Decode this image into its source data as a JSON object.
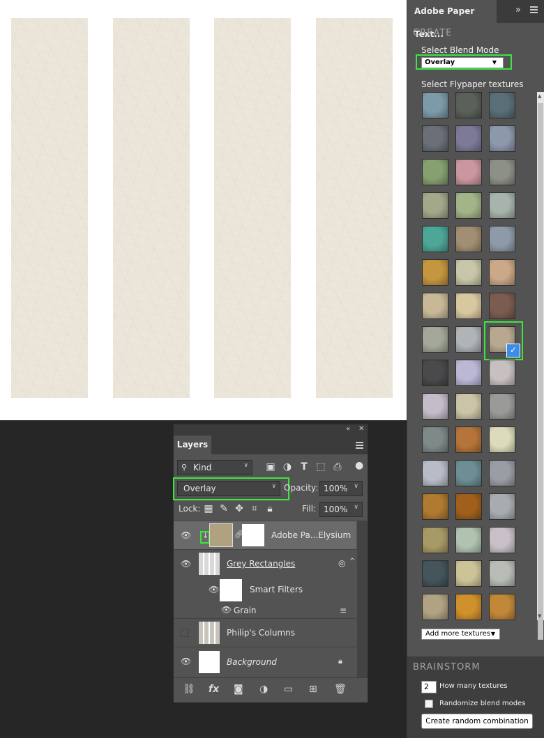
{
  "canvas": {
    "columns": 4
  },
  "panel": {
    "title": "Adobe Paper Text...",
    "create_header": "CREATE",
    "blend_label": "Select Blend Mode",
    "blend_value": "Overlay",
    "textures_label": "Select Flypaper textures",
    "textures": [
      "#7d9aa8",
      "#5a6158",
      "#5a6e78",
      "#6a6f78",
      "#7d7a98",
      "#8c98ac",
      "#86a070",
      "#cc96a0",
      "#8c9086",
      "#a4a88a",
      "#a2b488",
      "#a6b4ac",
      "#4ea698",
      "#a28e72",
      "#8e9aa8",
      "#c49640",
      "#c8c6a8",
      "#caa888",
      "#c8b898",
      "#d8c8a0",
      "#7c5c50",
      "#a4a898",
      "#b0b4b6",
      "#b8a890",
      "#4a4a4c",
      "#bab8d4",
      "#c8c0c0",
      "#c4bcc8",
      "#ccc4a6",
      "#9a9a98",
      "#7e8a88",
      "#b4743a",
      "#dcdcbc",
      "#b8bcc8",
      "#6c8e94",
      "#9a9ea4",
      "#b07a30",
      "#a0601c",
      "#a8acb0",
      "#a89a66",
      "#b0c2b0",
      "#c8c0c6",
      "#44565c",
      "#ccc498",
      "#b8bcb6",
      "#b0a282",
      "#d0902c",
      "#c08838"
    ],
    "selected_texture_index": 23,
    "add_more_label": "Add more textures",
    "brainstorm_header": "BRAINSTORM",
    "how_many_value": "2",
    "how_many_label": "How many textures",
    "randomize_label": "Randomize blend modes",
    "create_button": "Create random combination"
  },
  "layers": {
    "tab": "Layers",
    "filter_kind": "Kind",
    "blend_mode": "Overlay",
    "opacity_label": "Opacity:",
    "opacity_value": "100%",
    "lock_label": "Lock:",
    "fill_label": "Fill:",
    "fill_value": "100%",
    "items": [
      {
        "name": "Adobe Pa...Elysium",
        "visible": true
      },
      {
        "name": "Grey Rectangles",
        "visible": true
      },
      {
        "name": "Smart Filters",
        "visible": true
      },
      {
        "name": "Grain",
        "visible": true
      },
      {
        "name": "Philip's Columns",
        "visible": false
      },
      {
        "name": "Background",
        "visible": true
      }
    ]
  },
  "colors": {
    "highlight": "#3ce63c",
    "check": "#3b8ee8",
    "paper": "#ece6da"
  }
}
